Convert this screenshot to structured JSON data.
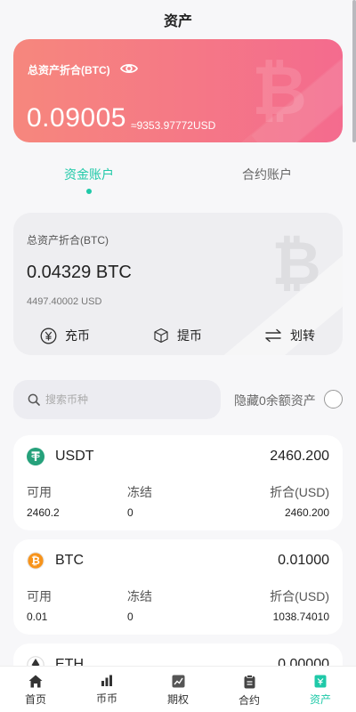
{
  "header": {
    "title": "资产"
  },
  "hero": {
    "label": "总资产折合(BTC)",
    "btc_value": "0.09005",
    "usd_value": "≈9353.97772USD"
  },
  "tabs": [
    {
      "label": "资金账户",
      "active": true
    },
    {
      "label": "合约账户",
      "active": false
    }
  ],
  "summary": {
    "label": "总资产折合(BTC)",
    "btc_value": "0.04329 BTC",
    "usd_value": "4497.40002 USD",
    "actions": [
      {
        "label": "充币",
        "icon": "yen-circle-icon"
      },
      {
        "label": "提币",
        "icon": "box-icon"
      },
      {
        "label": "划转",
        "icon": "transfer-arrows-icon"
      }
    ]
  },
  "search": {
    "placeholder": "搜索币种",
    "value": ""
  },
  "hide_zero": {
    "label": "隐藏0余额资产",
    "checked": false
  },
  "columns": {
    "available": "可用",
    "frozen": "冻结",
    "value_usd": "折合(USD)"
  },
  "assets": [
    {
      "symbol": "USDT",
      "total": "2460.200",
      "available": "2460.2",
      "frozen": "0",
      "value_usd": "2460.200",
      "icon": "tether-icon",
      "color": "#26a17b"
    },
    {
      "symbol": "BTC",
      "total": "0.01000",
      "available": "0.01",
      "frozen": "0",
      "value_usd": "1038.74010",
      "icon": "bitcoin-icon",
      "color": "#f7931a"
    },
    {
      "symbol": "ETH",
      "total": "0.00000",
      "icon": "ethereum-icon",
      "color": "#333333"
    }
  ],
  "nav": [
    {
      "label": "首页",
      "icon": "home-icon",
      "active": false
    },
    {
      "label": "币币",
      "icon": "bar-chart-icon",
      "active": false
    },
    {
      "label": "期权",
      "icon": "trend-chart-icon",
      "active": false
    },
    {
      "label": "合约",
      "icon": "clipboard-icon",
      "active": false
    },
    {
      "label": "资产",
      "icon": "wallet-icon",
      "active": true
    }
  ],
  "colors": {
    "accent": "#1fc9a8",
    "hero_from": "#f6877d",
    "hero_to": "#f46b8e"
  }
}
